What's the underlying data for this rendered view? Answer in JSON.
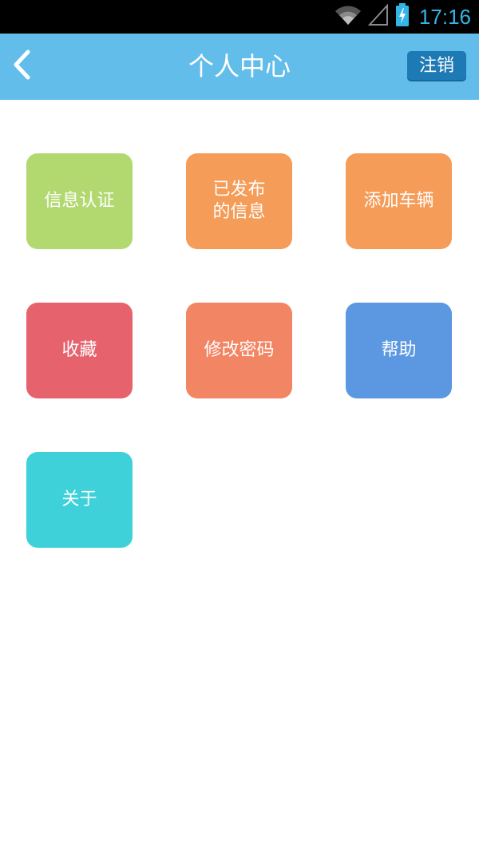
{
  "status_bar": {
    "time": "17:16",
    "icons": [
      "wifi-icon",
      "signal-icon",
      "battery-charging-icon"
    ]
  },
  "app_bar": {
    "back_icon": "chevron-left-icon",
    "title": "个人中心",
    "logout_label": "注销"
  },
  "colors": {
    "app_bar": "#62bdea",
    "logout_button": "#1e7ab4",
    "status_time": "#33b5e5"
  },
  "tiles": [
    {
      "label": "信息认证",
      "color": "#b2d870"
    },
    {
      "label": "已发布\n的信息",
      "color": "#f49c58"
    },
    {
      "label": "添加车辆",
      "color": "#f49c58"
    },
    {
      "label": "收藏",
      "color": "#e6636e"
    },
    {
      "label": "修改密码",
      "color": "#f28563"
    },
    {
      "label": "帮助",
      "color": "#5b98e1"
    },
    {
      "label": "关于",
      "color": "#3fd1d9"
    }
  ]
}
